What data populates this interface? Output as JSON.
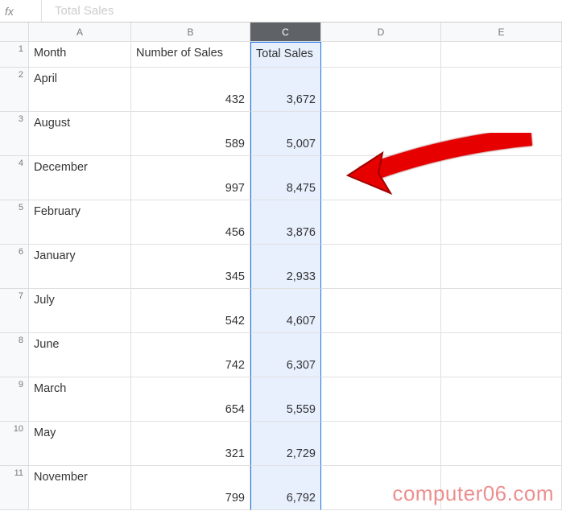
{
  "formula_bar": {
    "fx": "fx",
    "value": "Total Sales"
  },
  "columns": [
    "A",
    "B",
    "C",
    "D",
    "E"
  ],
  "selected_column_index": 2,
  "headers": {
    "A": "Month",
    "B": "Number of Sales",
    "C": "Total Sales"
  },
  "rows": [
    {
      "n": "1"
    },
    {
      "n": "2",
      "A": "April",
      "B": "432",
      "C": "3,672"
    },
    {
      "n": "3",
      "A": "August",
      "B": "589",
      "C": "5,007"
    },
    {
      "n": "4",
      "A": "December",
      "B": "997",
      "C": "8,475"
    },
    {
      "n": "5",
      "A": "February",
      "B": "456",
      "C": "3,876"
    },
    {
      "n": "6",
      "A": "January",
      "B": "345",
      "C": "2,933"
    },
    {
      "n": "7",
      "A": "July",
      "B": "542",
      "C": "4,607"
    },
    {
      "n": "8",
      "A": "June",
      "B": "742",
      "C": "6,307"
    },
    {
      "n": "9",
      "A": "March",
      "B": "654",
      "C": "5,559"
    },
    {
      "n": "10",
      "A": "May",
      "B": "321",
      "C": "2,729"
    },
    {
      "n": "11",
      "A": "November",
      "B": "799",
      "C": "6,792"
    }
  ],
  "watermark": "computer06.com",
  "chart_data": {
    "type": "table",
    "title": "Total Sales",
    "columns": [
      "Month",
      "Number of Sales",
      "Total Sales"
    ],
    "data": [
      [
        "April",
        432,
        3672
      ],
      [
        "August",
        589,
        5007
      ],
      [
        "December",
        997,
        8475
      ],
      [
        "February",
        456,
        3876
      ],
      [
        "January",
        345,
        2933
      ],
      [
        "July",
        542,
        4607
      ],
      [
        "June",
        742,
        6307
      ],
      [
        "March",
        654,
        5559
      ],
      [
        "May",
        321,
        2729
      ],
      [
        "November",
        799,
        6792
      ]
    ]
  }
}
